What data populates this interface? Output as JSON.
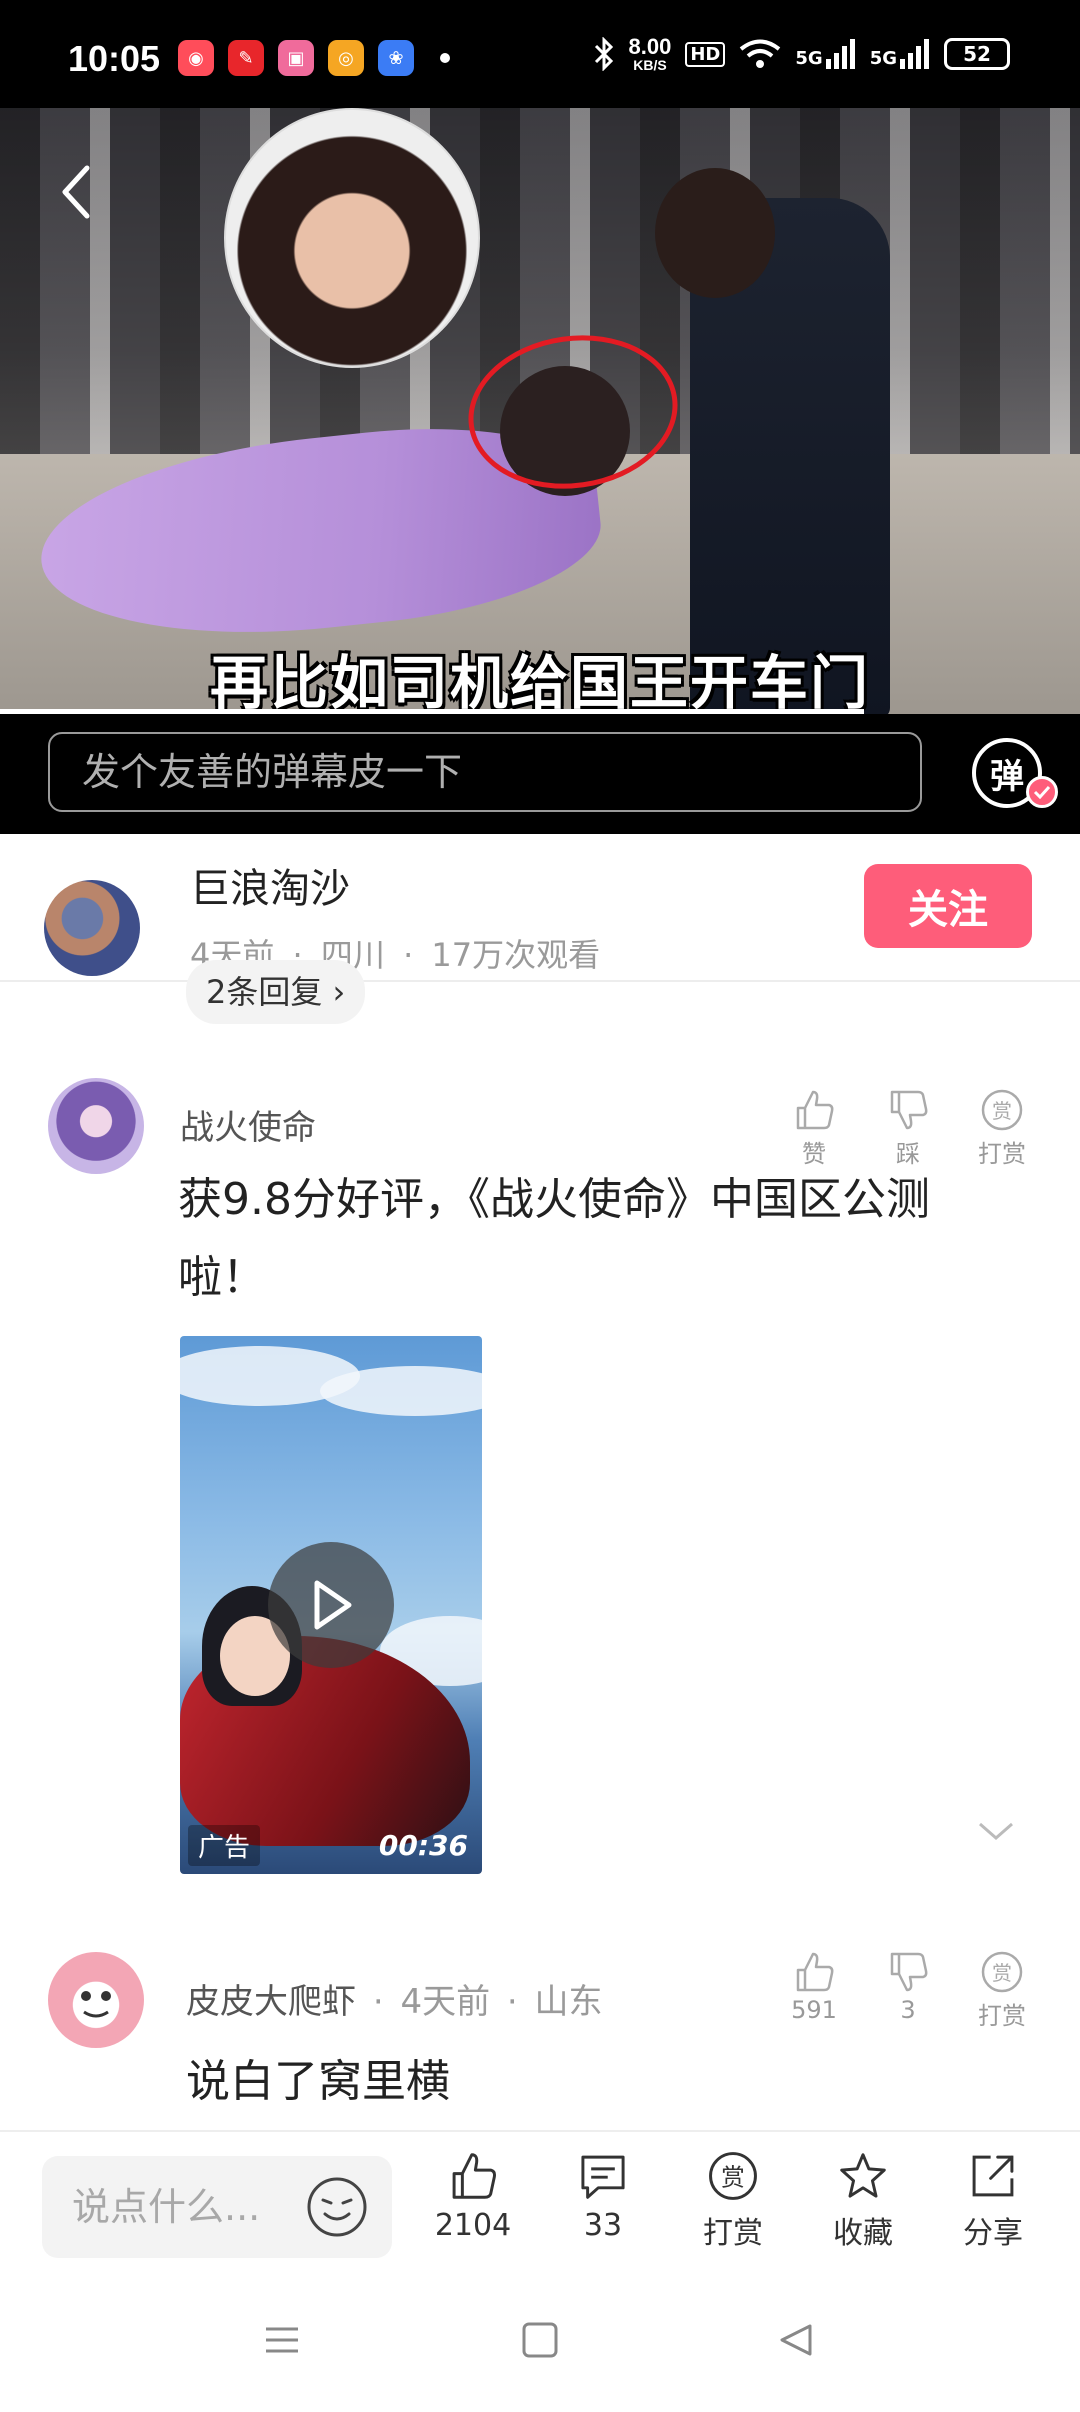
{
  "status_bar": {
    "time": "10:05",
    "net_speed_value": "8.00",
    "net_speed_unit": "KB/S",
    "hd_badge": "HD",
    "signal_1": "5G",
    "signal_2": "5G",
    "battery": "52",
    "app_icons": [
      "xiaohongshu-icon",
      "news-icon",
      "bilibili-icon",
      "weibo-icon",
      "baidu-icon"
    ]
  },
  "video": {
    "subtitle": "再比如司机给国王开车门",
    "progress_fraction": 0.8
  },
  "danmaku": {
    "placeholder": "发个友善的弹幕皮一下",
    "toggle_label": "弹"
  },
  "author": {
    "name": "巨浪淘沙",
    "time": "4天前",
    "location": "四川",
    "views": "17万次观看",
    "separator": "·",
    "follow_label": "关注"
  },
  "replies_pill": "2条回复 ›",
  "ad_comment": {
    "name": "战火使命",
    "text_line1": "获9.8分好评，《战火使命》中国区公测",
    "text_line2": "啦！",
    "like_label": "赞",
    "dislike_label": "踩",
    "reward_label": "打赏",
    "ad_label": "广告",
    "duration": "00:36"
  },
  "comment": {
    "name": "皮皮大爬虾",
    "time": "4天前",
    "location": "山东",
    "text": "说白了窝里横",
    "likes": "591",
    "dislikes": "3",
    "reward_label": "打赏"
  },
  "bottom_bar": {
    "placeholder": "说点什么...",
    "likes": "2104",
    "comments": "33",
    "reward": "打赏",
    "favorite": "收藏",
    "share": "分享"
  },
  "colors": {
    "accent": "#fe5d7a",
    "subtitle": "#ffffff",
    "circle_highlight": "#e31b23"
  }
}
